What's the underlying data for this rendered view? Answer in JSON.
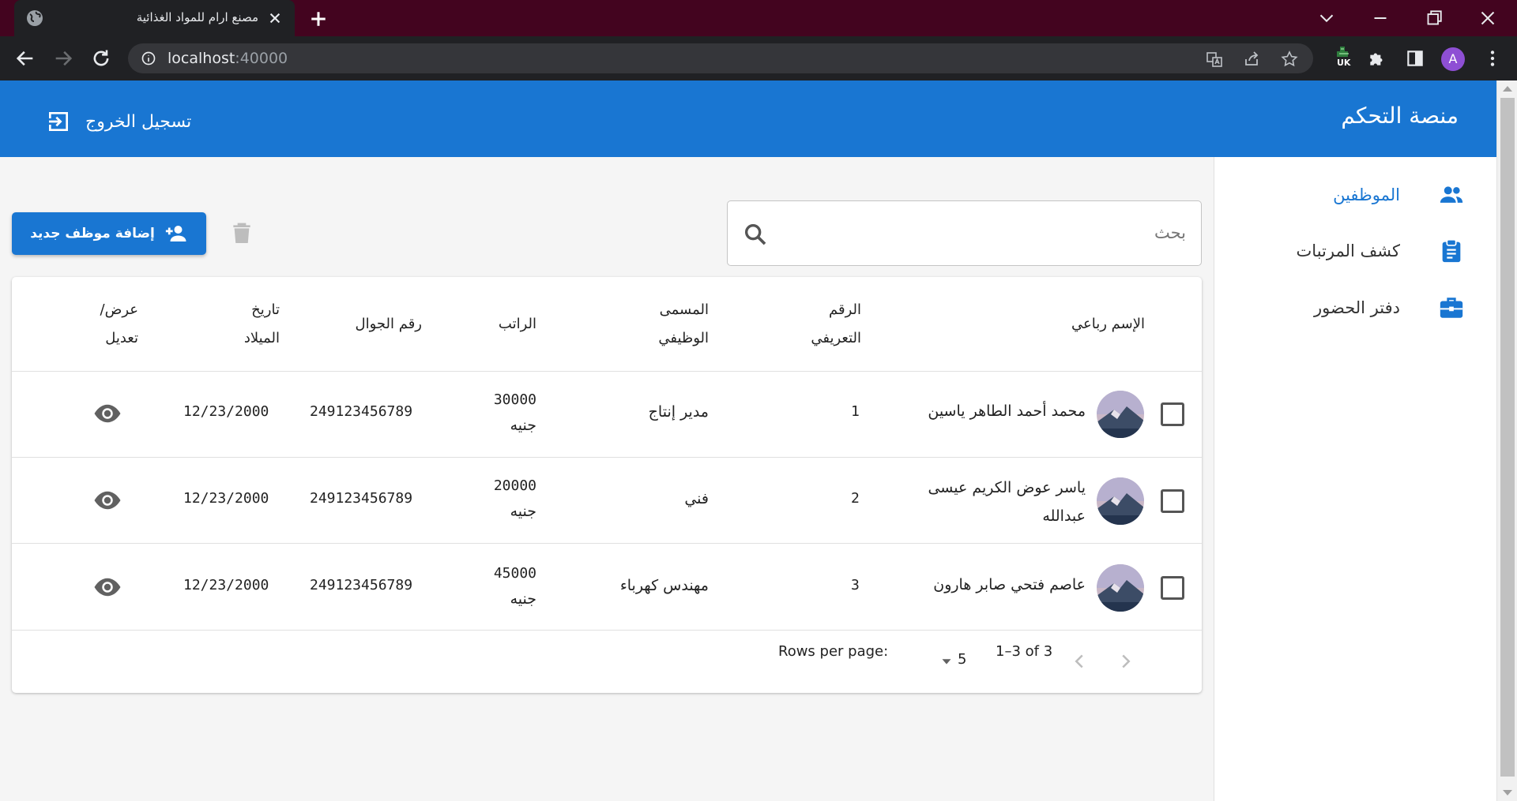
{
  "browser": {
    "tab_title": "مصنع ارام للمواد الغذائية",
    "url_host": "localhost",
    "url_port": ":40000",
    "extension_badge": "UK",
    "profile_initial": "A"
  },
  "header": {
    "title": "منصة التحكم",
    "logout_label": "تسجيل الخروج"
  },
  "sidebar": {
    "items": [
      {
        "label": "الموظفين",
        "icon": "people-icon",
        "active": true
      },
      {
        "label": "كشف المرتبات",
        "icon": "clipboard-icon",
        "active": false
      },
      {
        "label": "دفتر الحضور",
        "icon": "briefcase-icon",
        "active": false
      }
    ]
  },
  "toolbar": {
    "search_placeholder": "بحث",
    "add_label": "إضافة موظف جديد"
  },
  "table": {
    "headers": {
      "name": "الإسم رباعي",
      "id_line1": "الرقم",
      "id_line2": "التعريفي",
      "title_line1": "المسمى",
      "title_line2": "الوظيفي",
      "salary": "الراتب",
      "phone": "رقم الجوال",
      "dob_line1": "تاريخ",
      "dob_line2": "الميلاد",
      "action_line1": "عرض/",
      "action_line2": "تعديل"
    },
    "rows": [
      {
        "name_line1": "محمد أحمد الطاهر ياسين",
        "name_line2": "",
        "id": "1",
        "title": "مدير إنتاج",
        "salary": "30000",
        "currency": "جنيه",
        "phone": "249123456789",
        "dob": "12/23/2000"
      },
      {
        "name_line1": "ياسر عوض الكريم عيسى",
        "name_line2": "عبدالله",
        "id": "2",
        "title": "فني",
        "salary": "20000",
        "currency": "جنيه",
        "phone": "249123456789",
        "dob": "12/23/2000"
      },
      {
        "name_line1": "عاصم فتحي صابر هارون",
        "name_line2": "",
        "id": "3",
        "title": "مهندس كهرباء",
        "salary": "45000",
        "currency": "جنيه",
        "phone": "249123456789",
        "dob": "12/23/2000"
      }
    ]
  },
  "pagination": {
    "rows_per_page_label": "Rows per page:",
    "rows_per_page_value": "5",
    "range_label": "1–3 of 3"
  },
  "colors": {
    "primary": "#1976d2",
    "tabbar": "#43041f",
    "chrome": "#202124"
  }
}
